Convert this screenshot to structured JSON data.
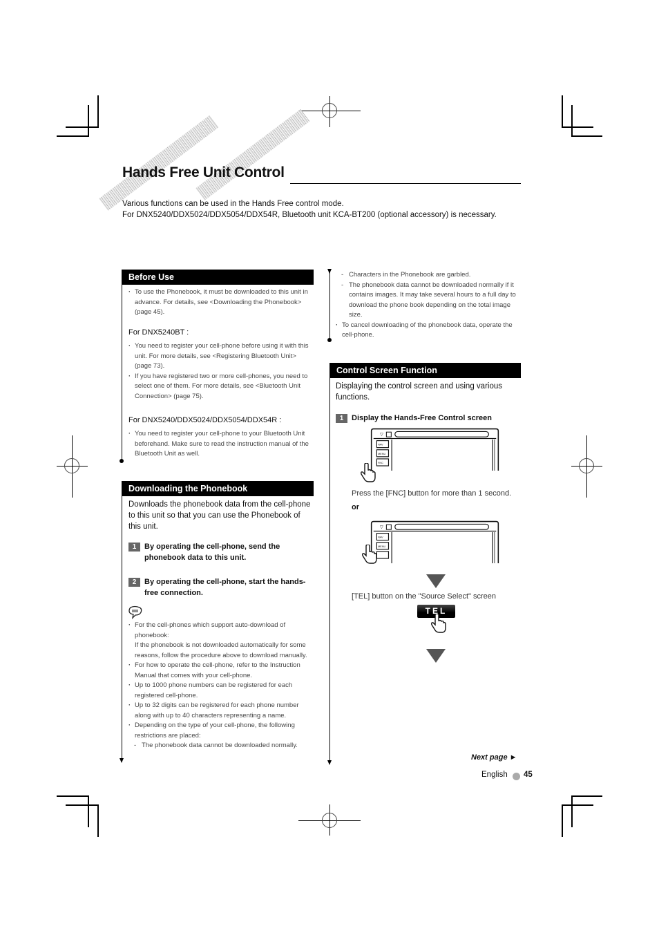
{
  "header": {
    "title": "Hands Free Unit Control",
    "intro_line1": "Various functions can be used in the Hands Free control mode.",
    "intro_line2": "For DNX5240/DDX5024/DDX5054/DDX54R, Bluetooth unit KCA-BT200 (optional accessory) is necessary."
  },
  "before_use": {
    "heading": "Before Use",
    "bullets": [
      "To use the Phonebook, it must be downloaded to this unit in advance. For details, see <Downloading the Phonebook> (page 45)."
    ],
    "model1": "For DNX5240BT :",
    "model1_bullets": [
      "You need to register your cell-phone before using it with this unit. For more details, see <Registering Bluetooth Unit> (page 73).",
      "If you have registered two or more cell-phones, you need to select one of them. For more details, see <Bluetooth Unit Connection> (page 75)."
    ],
    "model2": "For DNX5240/DDX5024/DDX5054/DDX54R :",
    "model2_bullets": [
      "You need to register your cell-phone to your Bluetooth Unit beforehand. Make sure to read the instruction manual of the Bluetooth Unit as well."
    ]
  },
  "downloading": {
    "heading": "Downloading the Phonebook",
    "description": "Downloads the phonebook data from the cell-phone to this unit so that you can use the Phonebook of this unit.",
    "steps": [
      {
        "num": "1",
        "text": "By operating the cell-phone, send the phonebook data to this unit."
      },
      {
        "num": "2",
        "text": "By operating the cell-phone, start the hands-free connection."
      }
    ],
    "note_icon": "note-speech-bubble-icon",
    "notes": [
      "For the cell-phones which support auto-download of phonebook:",
      "If the phonebook is not downloaded automatically for some reasons, follow the procedure above to download manually.",
      "For how to operate the cell-phone, refer to the Instruction Manual that comes with your cell-phone.",
      "Up to 1000 phone numbers can be registered for each registered cell-phone.",
      "Up to 32 digits can be registered for each phone number along with up to 40 characters representing a name.",
      "Depending on the type of your cell-phone, the following restrictions are placed:",
      "The phonebook data cannot be downloaded normally."
    ],
    "notes_cont": [
      "Characters in the Phonebook are garbled.",
      "The phonebook data cannot be downloaded normally if it contains images. It may take several hours to a full day to download the phone book depending on the total image size.",
      "To cancel downloading of the phonebook data, operate the cell-phone."
    ]
  },
  "control_screen": {
    "heading": "Control Screen Function",
    "description": "Displaying the control screen and using various functions.",
    "step1_num": "1",
    "step1_text": "Display the Hands-Free Control screen",
    "caption1": "Press the [FNC] button for more than 1 second.",
    "or": "or",
    "caption2": "[TEL] button on the \"Source Select\" screen",
    "tel_label": "TEL",
    "device_buttons": [
      "NAV",
      "MENU",
      "FNC"
    ]
  },
  "footer": {
    "next_page": "Next page ►",
    "language": "English",
    "page_number": "45"
  }
}
